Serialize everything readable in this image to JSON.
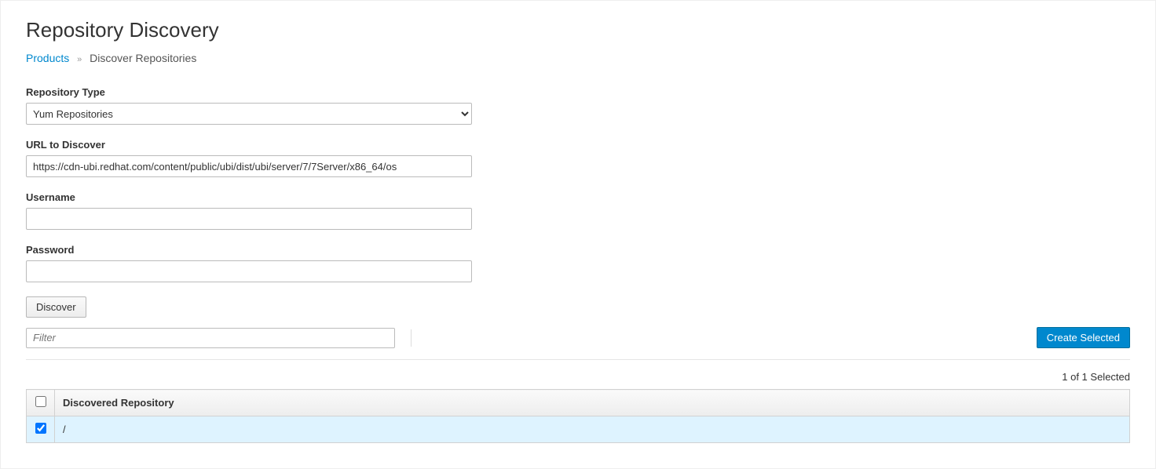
{
  "header": {
    "title": "Repository Discovery"
  },
  "breadcrumb": {
    "root": "Products",
    "current": "Discover Repositories"
  },
  "form": {
    "repo_type_label": "Repository Type",
    "repo_type_value": "Yum Repositories",
    "url_label": "URL to Discover",
    "url_value": "https://cdn-ubi.redhat.com/content/public/ubi/dist/ubi/server/7/7Server/x86_64/os",
    "username_label": "Username",
    "username_value": "",
    "password_label": "Password",
    "password_value": "",
    "discover_button": "Discover"
  },
  "filter": {
    "placeholder": "Filter"
  },
  "actions": {
    "create_selected": "Create Selected"
  },
  "results": {
    "selected_text": "1 of 1 Selected",
    "column_header": "Discovered Repository",
    "rows": [
      {
        "path": "/",
        "checked": true
      }
    ]
  }
}
